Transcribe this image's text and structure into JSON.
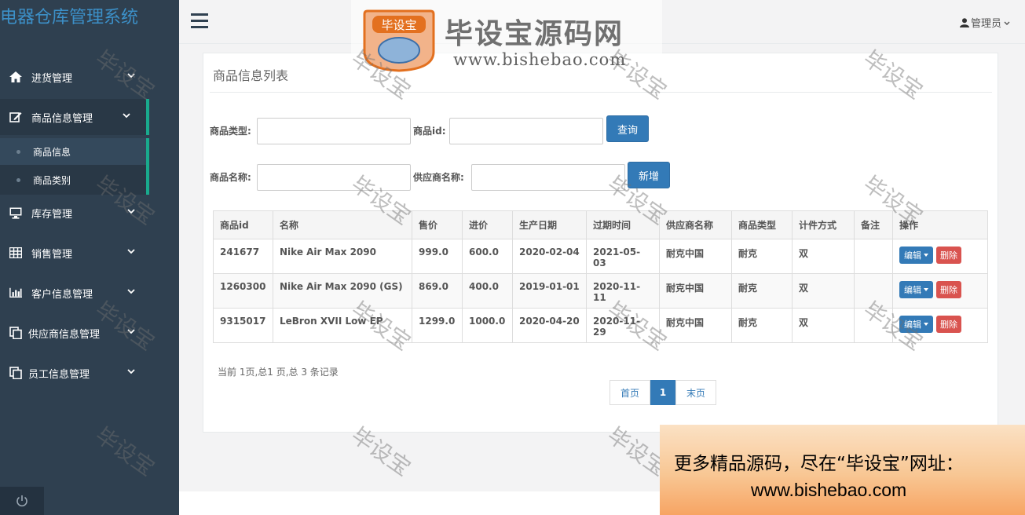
{
  "app": {
    "title": "电器仓库管理系统"
  },
  "user": {
    "name": "管理员"
  },
  "sidebar": {
    "items": [
      {
        "label": "进货管理",
        "icon": "home-icon"
      },
      {
        "label": "商品信息管理",
        "icon": "edit-icon"
      },
      {
        "label": "库存管理",
        "icon": "monitor-icon"
      },
      {
        "label": "销售管理",
        "icon": "table-icon"
      },
      {
        "label": "客户信息管理",
        "icon": "bar-chart-icon"
      },
      {
        "label": "供应商信息管理",
        "icon": "copy-icon"
      },
      {
        "label": "员工信息管理",
        "icon": "copy-icon"
      }
    ],
    "subitems": [
      {
        "label": "商品信息"
      },
      {
        "label": "商品类别"
      }
    ]
  },
  "panel": {
    "title": "商品信息列表"
  },
  "filters": {
    "type_label": "商品类型:",
    "id_label": "商品id:",
    "query_label": "查询",
    "name_label": "商品名称:",
    "supplier_label": "供应商名称:",
    "add_label": "新增"
  },
  "table": {
    "headers": [
      "商品id",
      "名称",
      "售价",
      "进价",
      "生产日期",
      "过期时间",
      "供应商名称",
      "商品类型",
      "计件方式",
      "备注",
      "操作"
    ],
    "rows": [
      [
        "241677",
        "Nike Air Max 2090",
        "999.0",
        "600.0",
        "2020-02-04",
        "2021-05-03",
        "耐克中国",
        "耐克",
        "双",
        ""
      ],
      [
        "1260300",
        "Nike Air Max 2090 (GS)",
        "869.0",
        "400.0",
        "2019-01-01",
        "2020-11-11",
        "耐克中国",
        "耐克",
        "双",
        ""
      ],
      [
        "9315017",
        "LeBron XVII Low EP",
        "1299.0",
        "1000.0",
        "2020-04-20",
        "2020-11-29",
        "耐克中国",
        "耐克",
        "双",
        ""
      ]
    ],
    "edit_label": "编辑",
    "delete_label": "删除"
  },
  "pagination": {
    "info": "当前 1页,总1 页,总 3 条记录",
    "first": "首页",
    "current": "1",
    "last": "末页"
  },
  "watermark": {
    "text": "毕设宝",
    "logo_badge": "毕设宝",
    "logo_title": "毕设宝源码网",
    "logo_url": "www.bishebao.com",
    "promo_line1": "更多精品源码，尽在“毕设宝”网址：",
    "promo_line2": "www.bishebao.com"
  },
  "colors": {
    "sidebar_bg": "#2f4050",
    "accent": "#19aa8d",
    "primary": "#337ab7",
    "danger": "#d9534f"
  }
}
